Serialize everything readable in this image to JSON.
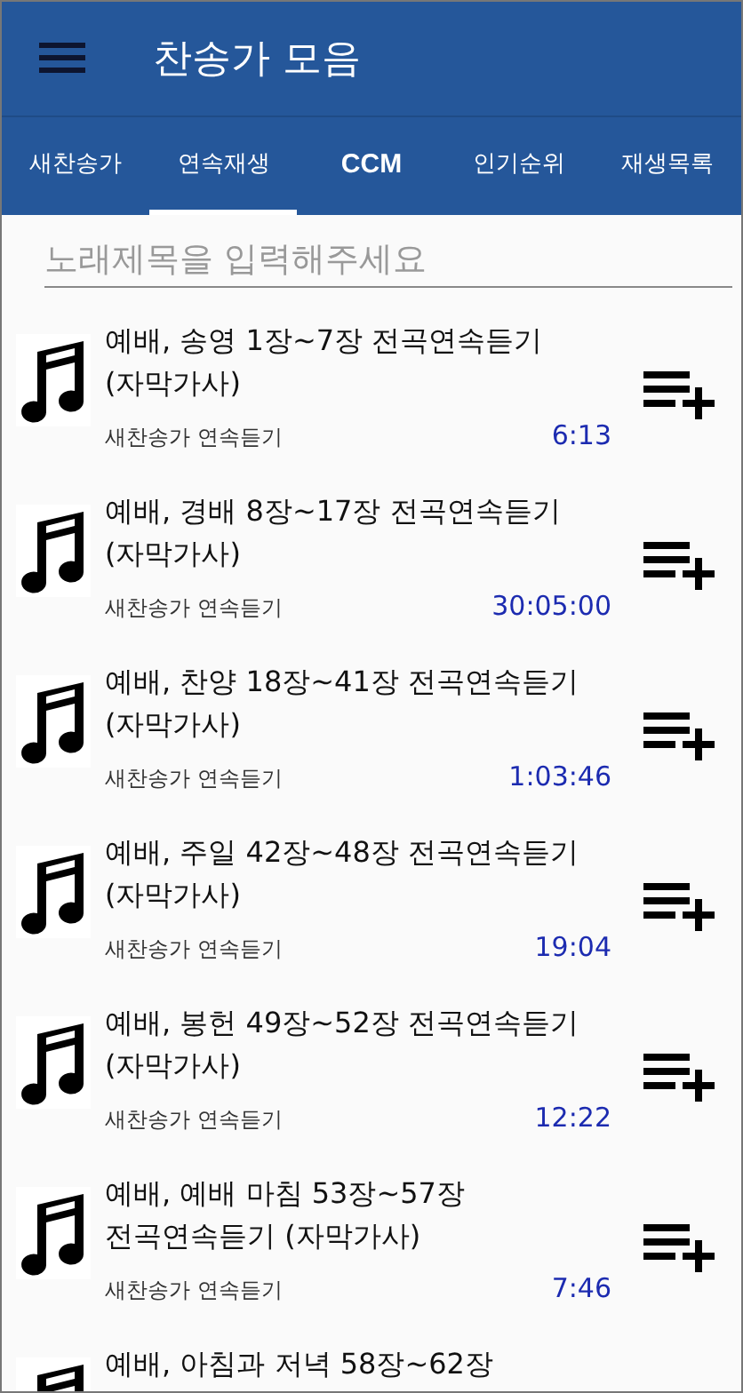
{
  "app_bar": {
    "title": "찬송가 모음"
  },
  "tabs": [
    {
      "label": "새찬송가",
      "selected": false
    },
    {
      "label": "연속재생",
      "selected": true
    },
    {
      "label": "CCM",
      "selected": false
    },
    {
      "label": "인기순위",
      "selected": false
    },
    {
      "label": "재생목록",
      "selected": false
    }
  ],
  "search": {
    "placeholder": "노래제목을 입력해주세요"
  },
  "songs": [
    {
      "title": "예배, 송영 1장~7장 전곡연속듣기 (자막가사)",
      "category": "새찬송가 연속듣기",
      "duration": "6:13"
    },
    {
      "title": "예배, 경배 8장~17장 전곡연속듣기 (자막가사)",
      "category": "새찬송가 연속듣기",
      "duration": "30:05:00"
    },
    {
      "title": "예배, 찬양 18장~41장 전곡연속듣기 (자막가사)",
      "category": "새찬송가 연속듣기",
      "duration": "1:03:46"
    },
    {
      "title": "예배, 주일 42장~48장 전곡연속듣기 (자막가사)",
      "category": "새찬송가 연속듣기",
      "duration": "19:04"
    },
    {
      "title": "예배, 봉헌 49장~52장 전곡연속듣기 (자막가사)",
      "category": "새찬송가 연속듣기",
      "duration": "12:22"
    },
    {
      "title": "예배, 예배 마침 53장~57장 전곡연속듣기 (자막가사)",
      "category": "새찬송가 연속듣기",
      "duration": "7:46"
    },
    {
      "title": "예배, 아침과 저녁 58장~62장"
    }
  ]
}
